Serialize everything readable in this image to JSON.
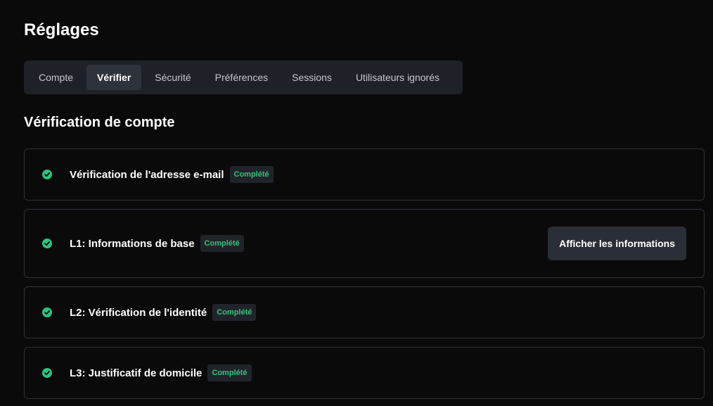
{
  "header": {
    "title": "Réglages"
  },
  "tabs": [
    {
      "label": "Compte",
      "active": false
    },
    {
      "label": "Vérifier",
      "active": true
    },
    {
      "label": "Sécurité",
      "active": false
    },
    {
      "label": "Préférences",
      "active": false
    },
    {
      "label": "Sessions",
      "active": false
    },
    {
      "label": "Utilisateurs ignorés",
      "active": false
    }
  ],
  "section": {
    "title": "Vérification de compte"
  },
  "verifications": [
    {
      "label": "Vérification de l'adresse e-mail",
      "status": "Complété"
    },
    {
      "label": "L1: Informations de base",
      "status": "Complété",
      "action": "Afficher les informations"
    },
    {
      "label": "L2: Vérification de l'identité",
      "status": "Complété"
    },
    {
      "label": "L3: Justificatif de domicile",
      "status": "Complété"
    }
  ],
  "colors": {
    "background": "#0a0a0b",
    "success": "#2ec27e",
    "tab_bar": "#1e2127",
    "tab_active": "#2e323a"
  },
  "icons": {
    "status_icon": "check-circle-icon"
  }
}
